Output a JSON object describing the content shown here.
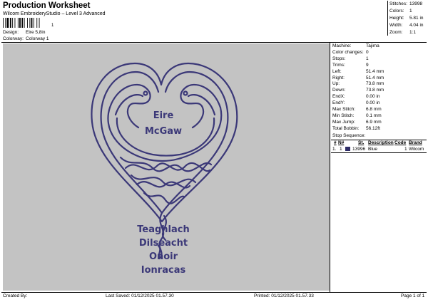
{
  "header": {
    "title": "Production Worksheet",
    "subtitle": "Wilcom EmbroideryStudio – Level 3 Advanced",
    "barcode_number": "1",
    "design_label": "Design:",
    "design_value": "Eire 5,8in",
    "colorway_label": "Colorway:",
    "colorway_value": "Colorway 1"
  },
  "summary": [
    {
      "label": "Stitches:",
      "value": "13998"
    },
    {
      "label": "Colors:",
      "value": "1"
    },
    {
      "label": "Height:",
      "value": "5.81 in"
    },
    {
      "label": "Width:",
      "value": "4.04 in"
    },
    {
      "label": "Zoom:",
      "value": "1:1"
    }
  ],
  "design_texts": {
    "line1": "Eire",
    "line2": "McGaw",
    "line3": "Teaghlach",
    "line4": "Dilseacht",
    "line5": "Onoir",
    "line6": "Ionracas"
  },
  "details": [
    {
      "label": "Machine:",
      "value": "Tajima"
    },
    {
      "label": "Color changes:",
      "value": "0"
    },
    {
      "label": "Stops:",
      "value": "1"
    },
    {
      "label": "Trims:",
      "value": "9"
    },
    {
      "label": "Left:",
      "value": "51.4 mm"
    },
    {
      "label": "Right:",
      "value": "51.4 mm"
    },
    {
      "label": "Up:",
      "value": "73.8 mm"
    },
    {
      "label": "Down:",
      "value": "73.8 mm"
    },
    {
      "label": "EndX:",
      "value": "0.00 in"
    },
    {
      "label": "EndY:",
      "value": "0.00 in"
    },
    {
      "label": "Max Stitch:",
      "value": "6.8 mm"
    },
    {
      "label": "Min Stitch:",
      "value": "0.1 mm"
    },
    {
      "label": "Max Jump:",
      "value": "6.9 mm"
    },
    {
      "label": "Total Bobbin:",
      "value": "56.12ft"
    }
  ],
  "stop_sequence": {
    "title": "Stop Sequence:",
    "headers": [
      "#",
      "N#",
      "St.",
      "Description",
      "Code",
      "Brand"
    ],
    "rows": [
      {
        "num": "1.",
        "n": "1",
        "stitches": "13996",
        "description": "Blue",
        "code": "1",
        "brand": "Wilcom",
        "swatch": "#2e2c66"
      }
    ]
  },
  "footer": {
    "created_by": "Created By:",
    "last_saved": "Last Saved: 01/12/2025 01.57.30",
    "printed": "Printed: 01/12/2025 01.57.33",
    "page": "Page 1 of 1"
  },
  "colors": {
    "thread": "#3b3878",
    "canvas": "#c3c3c3"
  }
}
